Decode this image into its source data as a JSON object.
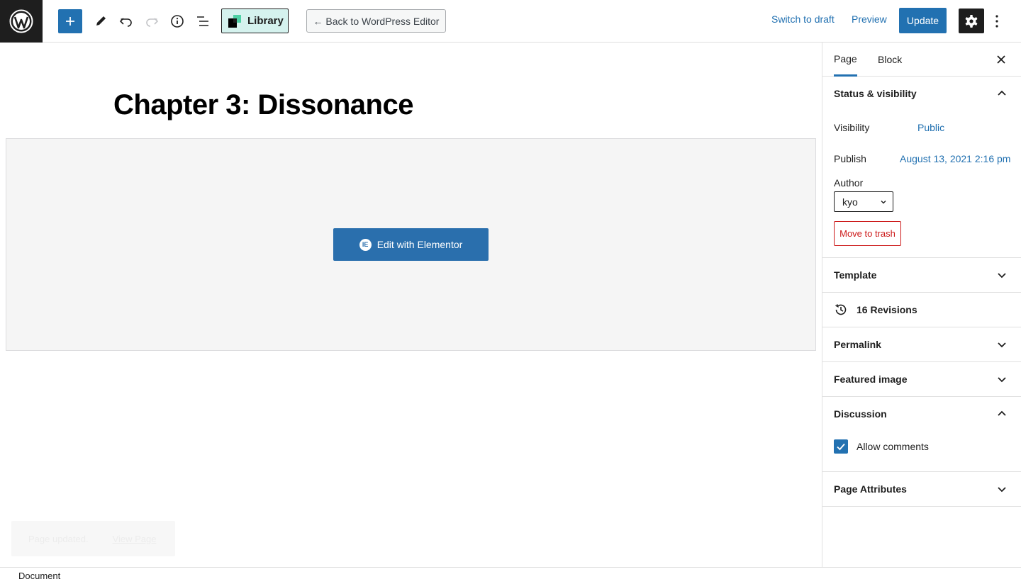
{
  "toolbar": {
    "library_label": "Library",
    "back_label": "← Back to WordPress Editor",
    "switch_draft_label": "Switch to draft",
    "preview_label": "Preview",
    "update_label": "Update"
  },
  "editor": {
    "title": "Chapter 3: Dissonance",
    "elementor_button_label": "Edit with Elementor",
    "elementor_icon_glyph": "IE"
  },
  "snackbar": {
    "message": "Page updated.",
    "link_label": "View Page"
  },
  "footer": {
    "breadcrumb": "Document"
  },
  "sidebar": {
    "tabs": [
      {
        "label": "Page",
        "active": true
      },
      {
        "label": "Block",
        "active": false
      }
    ],
    "status": {
      "heading": "Status & visibility",
      "expanded": true,
      "visibility_label": "Visibility",
      "visibility_value": "Public",
      "publish_label": "Publish",
      "publish_value": "August 13, 2021 2:16 pm",
      "author_label": "Author",
      "author_value": "kyo",
      "trash_label": "Move to trash"
    },
    "template": {
      "heading": "Template",
      "expanded": false
    },
    "revisions": {
      "label": "16 Revisions"
    },
    "permalink": {
      "heading": "Permalink",
      "expanded": false
    },
    "featured_image": {
      "heading": "Featured image",
      "expanded": false
    },
    "discussion": {
      "heading": "Discussion",
      "expanded": true,
      "allow_comments_label": "Allow comments",
      "allow_comments_checked": true
    },
    "page_attributes": {
      "heading": "Page Attributes",
      "expanded": false
    }
  },
  "colors": {
    "accent": "#2271b1",
    "elementor": "#2a6fad",
    "danger": "#cc1818",
    "library_bg": "#d5f2ee",
    "dark": "#1e1e1e"
  },
  "icons": {
    "logo": "wordpress-logo-icon",
    "add": "plus-icon",
    "tools": "pencil-icon",
    "undo": "undo-icon",
    "redo": "redo-icon",
    "details": "info-icon",
    "outline": "list-view-icon",
    "settings": "gear-icon",
    "more": "vertical-ellipsis-icon",
    "close": "close-icon",
    "revisions": "history-icon"
  }
}
